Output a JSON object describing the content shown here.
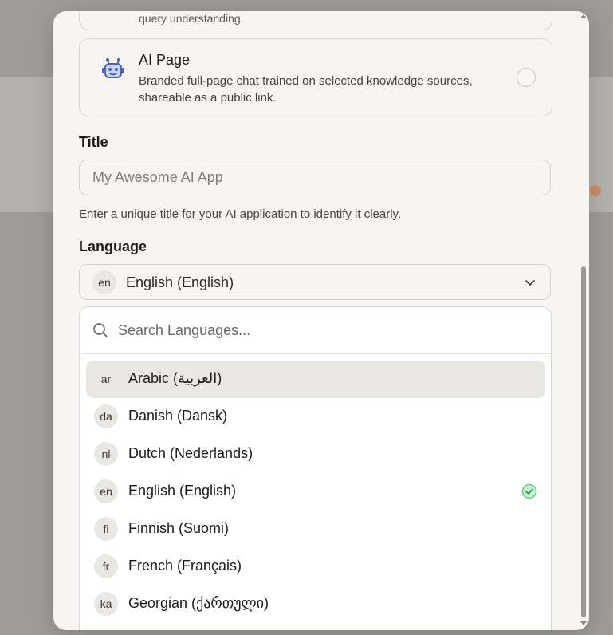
{
  "partial_text": "query understanding.",
  "ai_card": {
    "icon": "robot-icon",
    "title": "AI Page",
    "description": "Branded full-page chat trained on selected knowledge sources, shareable as a public link."
  },
  "title_field": {
    "label": "Title",
    "placeholder": "My Awesome AI App",
    "value": "",
    "helper": "Enter a unique title for your AI application to identify it clearly."
  },
  "language_field": {
    "label": "Language",
    "selected_code": "en",
    "selected_label": "English (English)"
  },
  "search": {
    "placeholder": "Search Languages..."
  },
  "languages": [
    {
      "code": "ar",
      "label": "Arabic (العربية)",
      "highlighted": true,
      "selected": false
    },
    {
      "code": "da",
      "label": "Danish (Dansk)",
      "highlighted": false,
      "selected": false
    },
    {
      "code": "nl",
      "label": "Dutch (Nederlands)",
      "highlighted": false,
      "selected": false
    },
    {
      "code": "en",
      "label": "English (English)",
      "highlighted": false,
      "selected": true
    },
    {
      "code": "fi",
      "label": "Finnish (Suomi)",
      "highlighted": false,
      "selected": false
    },
    {
      "code": "fr",
      "label": "French (Français)",
      "highlighted": false,
      "selected": false
    },
    {
      "code": "ka",
      "label": "Georgian (ქართული)",
      "highlighted": false,
      "selected": false
    }
  ],
  "colors": {
    "accent_check": "#5fcf87",
    "bot_icon": "#4a5fb5",
    "highlight_row": "#e9e7e2"
  }
}
